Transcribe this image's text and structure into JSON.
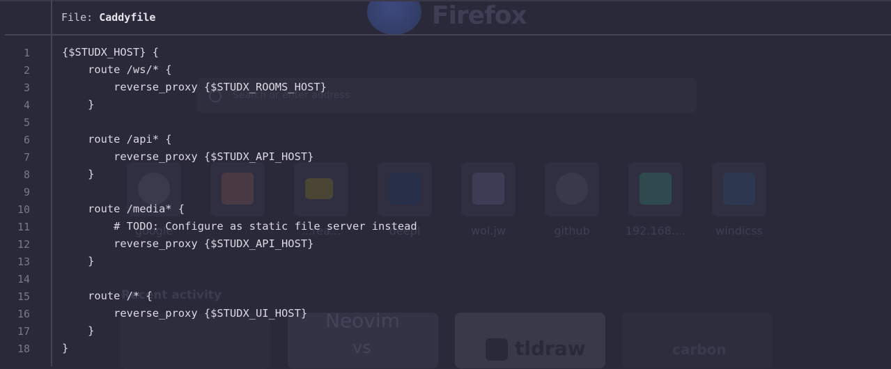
{
  "background": {
    "browser_name": "Firefox",
    "search_placeholder": "Search or enter address",
    "shortcuts": [
      {
        "label": "google",
        "icon": "google-icon"
      },
      {
        "label": "",
        "icon": "lastpass-icon"
      },
      {
        "label": "...rea...",
        "icon": "mtn-icon"
      },
      {
        "label": "deepl",
        "icon": "deepl-icon"
      },
      {
        "label": "wol.jw",
        "icon": "wol-icon"
      },
      {
        "label": "github",
        "icon": "github-icon"
      },
      {
        "label": "192.168....",
        "icon": "router-icon"
      },
      {
        "label": "windicss",
        "icon": "wind-icon"
      }
    ],
    "recent_activity_title": "Recent activity",
    "recent_cards": [
      {
        "title": "Neovim",
        "subtitle": "vs"
      },
      {
        "title": "tldraw"
      },
      {
        "title": "carbon"
      }
    ]
  },
  "editor": {
    "header_label": "File:",
    "file_name": "Caddyfile",
    "lines": [
      {
        "n": "1",
        "text": "{$STUDX_HOST} {"
      },
      {
        "n": "2",
        "text": "    route /ws/* {"
      },
      {
        "n": "3",
        "text": "        reverse_proxy {$STUDX_ROOMS_HOST}"
      },
      {
        "n": "4",
        "text": "    }"
      },
      {
        "n": "5",
        "text": ""
      },
      {
        "n": "6",
        "text": "    route /api* {"
      },
      {
        "n": "7",
        "text": "        reverse_proxy {$STUDX_API_HOST}"
      },
      {
        "n": "8",
        "text": "    }"
      },
      {
        "n": "9",
        "text": ""
      },
      {
        "n": "10",
        "text": "    route /media* {"
      },
      {
        "n": "11",
        "text": "        # TODO: Configure as static file server instead"
      },
      {
        "n": "12",
        "text": "        reverse_proxy {$STUDX_API_HOST}"
      },
      {
        "n": "13",
        "text": "    }"
      },
      {
        "n": "14",
        "text": ""
      },
      {
        "n": "15",
        "text": "    route /* {"
      },
      {
        "n": "16",
        "text": "        reverse_proxy {$STUDX_UI_HOST}"
      },
      {
        "n": "17",
        "text": "    }"
      },
      {
        "n": "18",
        "text": "}"
      }
    ]
  }
}
